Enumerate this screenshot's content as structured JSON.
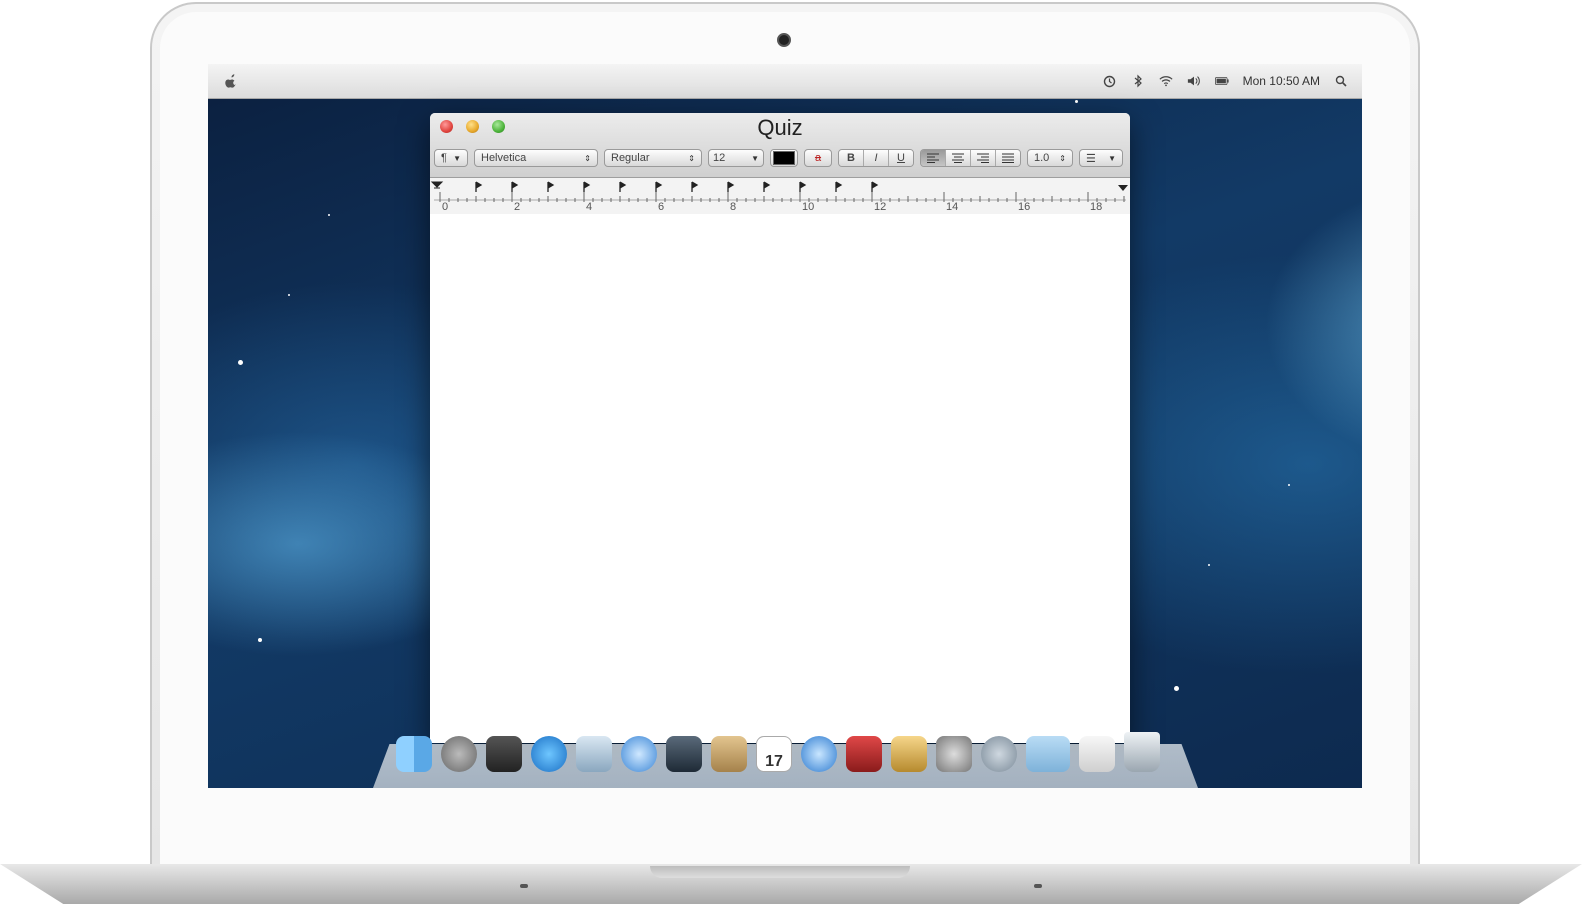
{
  "window": {
    "title": "Quiz",
    "toolbar": {
      "paragraph_label": "¶",
      "font_family": "Helvetica",
      "font_style": "Regular",
      "font_size": "12",
      "text_color": "#000000",
      "highlight_label": "a",
      "bold_label": "B",
      "italic_label": "I",
      "underline_label": "U",
      "alignment_options": [
        "left",
        "center",
        "right",
        "justify"
      ],
      "selected_alignment": "left",
      "line_spacing": "1.0",
      "list_label": "☰"
    },
    "ruler": {
      "labels": [
        "0",
        "2",
        "4",
        "6",
        "8",
        "10",
        "12",
        "14",
        "16",
        "18"
      ]
    }
  },
  "menubar": {
    "clock": "Mon 10:50 AM",
    "icons": [
      "time-machine-icon",
      "bluetooth-icon",
      "wifi-icon",
      "volume-icon",
      "battery-icon",
      "spotlight-icon"
    ]
  },
  "dock": {
    "apps": [
      "finder-icon",
      "launchpad-icon",
      "mission-control-icon",
      "app-store-icon",
      "mail-icon",
      "safari-icon",
      "facetime-icon",
      "contacts-icon",
      "calendar-icon",
      "itunes-icon",
      "photo-booth-icon",
      "preview-icon",
      "system-preferences-icon",
      "utilities-icon",
      "documents-folder-icon",
      "pages-icon",
      "trash-icon"
    ],
    "calendar_day": "17"
  }
}
